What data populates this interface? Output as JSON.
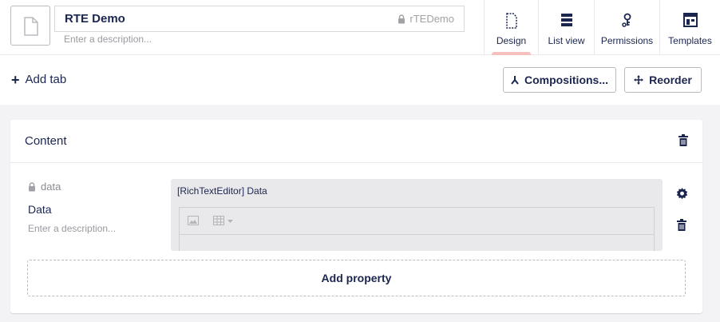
{
  "header": {
    "name": "RTE Demo",
    "alias": "rTEDemo",
    "description_placeholder": "Enter a description...",
    "tabs": [
      {
        "label": "Design",
        "icon": "design-icon",
        "active": true
      },
      {
        "label": "List view",
        "icon": "list-view-icon",
        "active": false
      },
      {
        "label": "Permissions",
        "icon": "permissions-icon",
        "active": false
      },
      {
        "label": "Templates",
        "icon": "templates-icon",
        "active": false
      }
    ]
  },
  "toolbar": {
    "add_tab": "Add tab",
    "compositions": "Compositions...",
    "reorder": "Reorder"
  },
  "group": {
    "title": "Content",
    "property": {
      "alias": "data",
      "name": "Data",
      "description_placeholder": "Enter a description...",
      "editor_label": "[RichTextEditor] Data"
    },
    "add_property": "Add property"
  },
  "colors": {
    "primary_text": "#1b264f",
    "active_tab_indicator": "#f5c1bc",
    "page_background": "#f3f3f5"
  }
}
